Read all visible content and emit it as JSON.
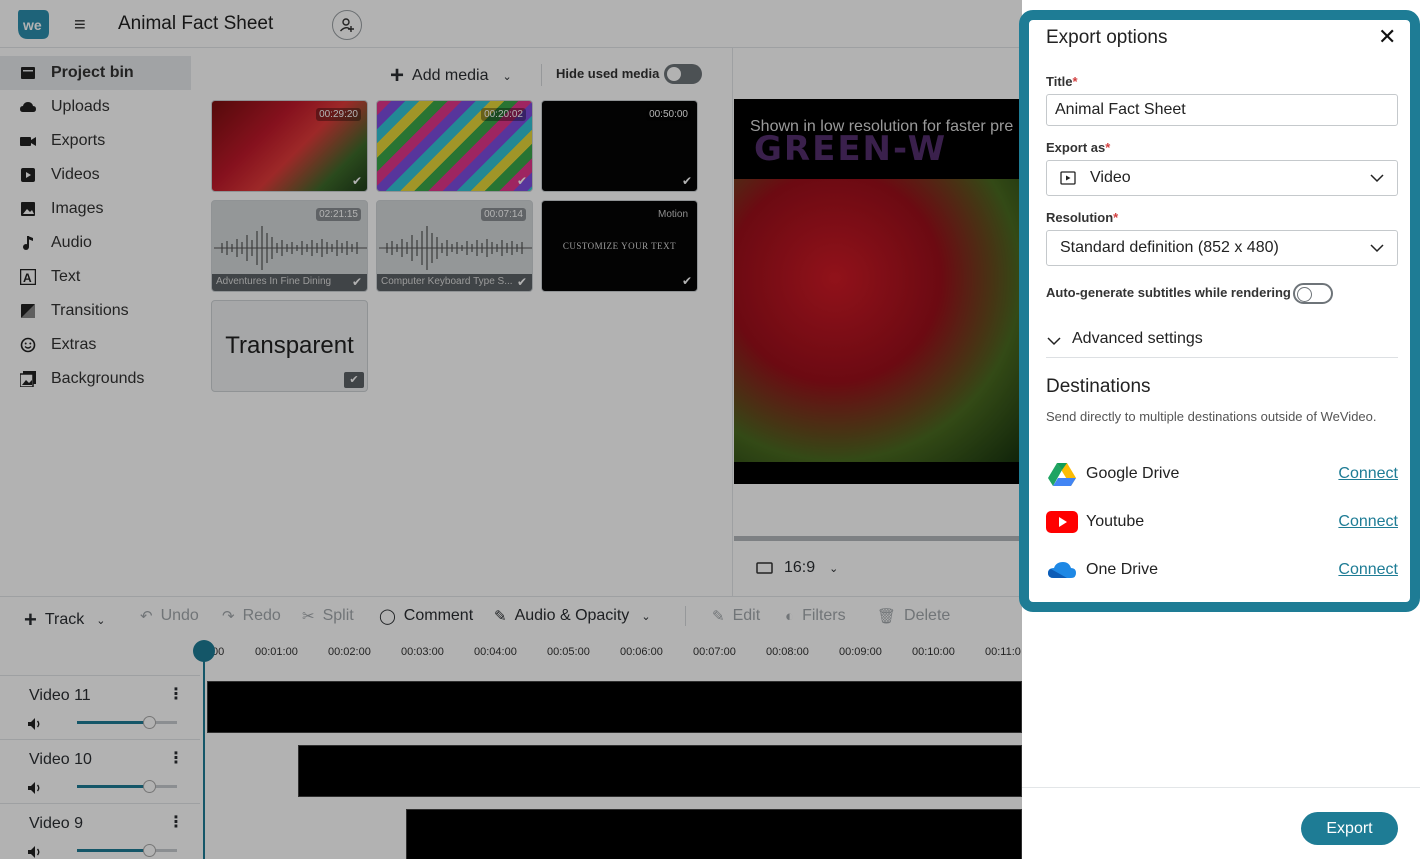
{
  "header": {
    "title": "Animal Fact Sheet"
  },
  "sidebar": {
    "items": [
      {
        "label": "Project bin",
        "icon": "folder-icon"
      },
      {
        "label": "Uploads",
        "icon": "cloud-upload-icon"
      },
      {
        "label": "Exports",
        "icon": "camera-icon"
      },
      {
        "label": "Videos",
        "icon": "play-icon"
      },
      {
        "label": "Images",
        "icon": "image-icon"
      },
      {
        "label": "Audio",
        "icon": "music-note-icon"
      },
      {
        "label": "Text",
        "icon": "text-icon"
      },
      {
        "label": "Transitions",
        "icon": "transition-icon"
      },
      {
        "label": "Extras",
        "icon": "smiley-icon"
      },
      {
        "label": "Backgrounds",
        "icon": "backgrounds-icon"
      }
    ]
  },
  "media": {
    "add_label": "Add media",
    "hide_used_label": "Hide used media",
    "thumbs": [
      {
        "duration": "00:29:20"
      },
      {
        "duration": "00:20:02"
      },
      {
        "duration": "00:50:00"
      },
      {
        "duration": "02:21:15",
        "caption": "Adventures In Fine Dining"
      },
      {
        "duration": "00:07:14",
        "caption": "Computer Keyboard Type S..."
      },
      {
        "badge": "Motion",
        "text": "CUSTOMIZE YOUR TEXT"
      },
      {
        "text": "Transparent"
      }
    ]
  },
  "preview": {
    "note": "Shown in low resolution for faster pre",
    "overlay_text": "GREEN-W",
    "aspect": "16:9"
  },
  "timeline": {
    "toolbar": {
      "track": "Track",
      "undo": "Undo",
      "redo": "Redo",
      "split": "Split",
      "comment": "Comment",
      "audio_opacity": "Audio & Opacity",
      "edit": "Edit",
      "filters": "Filters",
      "delete": "Delete"
    },
    "ticks": [
      "00",
      "00:01:00",
      "00:02:00",
      "00:03:00",
      "00:04:00",
      "00:05:00",
      "00:06:00",
      "00:07:00",
      "00:08:00",
      "00:09:00",
      "00:10:00",
      "00:11:0"
    ],
    "tracks": [
      {
        "name": "Video 11"
      },
      {
        "name": "Video 10"
      },
      {
        "name": "Video 9"
      }
    ]
  },
  "export": {
    "title": "Export options",
    "title_label": "Title",
    "title_value": "Animal Fact Sheet",
    "export_as_label": "Export as",
    "export_as_value": "Video",
    "resolution_label": "Resolution",
    "resolution_value": "Standard definition (852 x 480)",
    "subtitles_label": "Auto-generate subtitles while rendering",
    "advanced_label": "Advanced settings",
    "destinations_heading": "Destinations",
    "destinations_sub": "Send directly to multiple destinations outside of WeVideo.",
    "destinations": [
      {
        "name": "Google Drive",
        "action": "Connect",
        "icon": "google-drive-icon"
      },
      {
        "name": "Youtube",
        "action": "Connect",
        "icon": "youtube-icon"
      },
      {
        "name": "One Drive",
        "action": "Connect",
        "icon": "onedrive-icon"
      }
    ],
    "export_button": "Export",
    "required_mark": "*"
  },
  "colors": {
    "accent": "#1e7c95",
    "required": "#d23f3f"
  }
}
